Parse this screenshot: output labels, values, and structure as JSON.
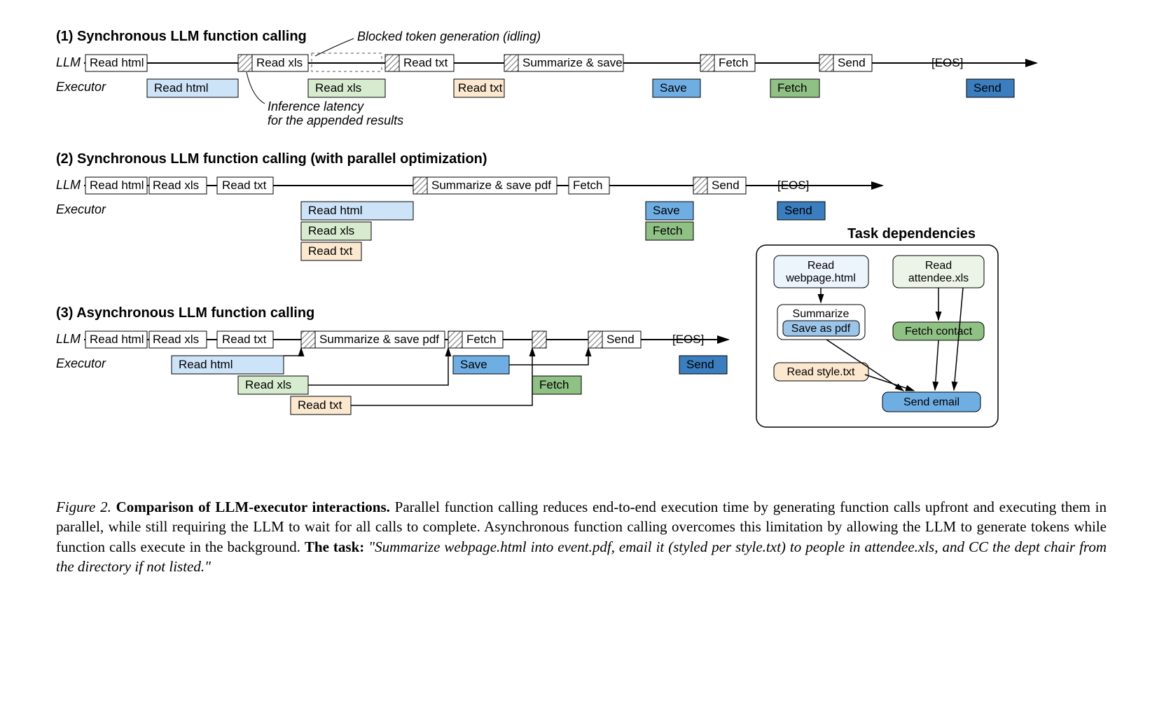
{
  "section1": {
    "title": "(1) Synchronous LLM function calling",
    "llm_label": "LLM",
    "exec_label": "Executor",
    "anno_blocked": "Blocked token generation (idling)",
    "anno_latency1": "Inference latency",
    "anno_latency2": "for the appended results",
    "tokens": {
      "read_html": "Read html",
      "read_xls": "Read xls",
      "read_txt": "Read txt",
      "summarize_save": "Summarize & save",
      "fetch": "Fetch",
      "send": "Send",
      "eos": "[EOS]"
    },
    "exec": {
      "read_html": "Read html",
      "read_xls": "Read xls",
      "read_txt": "Read txt",
      "save": "Save",
      "fetch": "Fetch",
      "send": "Send"
    }
  },
  "section2": {
    "title": "(2) Synchronous LLM function calling (with parallel optimization)",
    "llm_label": "LLM",
    "exec_label": "Executor",
    "tokens": {
      "read_html": "Read html",
      "read_xls": "Read xls",
      "read_txt": "Read txt",
      "summarize_save_pdf": "Summarize & save pdf",
      "fetch": "Fetch",
      "send": "Send",
      "eos": "[EOS]"
    },
    "exec": {
      "read_html": "Read html",
      "read_xls": "Read xls",
      "read_txt": "Read txt",
      "save": "Save",
      "fetch": "Fetch",
      "send": "Send"
    }
  },
  "section3": {
    "title": "(3) Asynchronous LLM function calling",
    "llm_label": "LLM",
    "exec_label": "Executor",
    "tokens": {
      "read_html": "Read html",
      "read_xls": "Read xls",
      "read_txt": "Read txt",
      "summarize_save_pdf": "Summarize & save pdf",
      "fetch": "Fetch",
      "send": "Send",
      "eos": "[EOS]"
    },
    "exec": {
      "read_html": "Read html",
      "read_xls": "Read xls",
      "read_txt": "Read txt",
      "save": "Save",
      "fetch": "Fetch",
      "send": "Send"
    }
  },
  "dependencies": {
    "title": "Task dependencies",
    "read_html1": "Read",
    "read_html2": "webpage.html",
    "read_xls1": "Read",
    "read_xls2": "attendee.xls",
    "summarize": "Summarize",
    "save_as_pdf": "Save as pdf",
    "read_style": "Read style.txt",
    "fetch_contact": "Fetch contact",
    "send_email": "Send email"
  },
  "caption": {
    "fig": "Figure 2.",
    "bold1": "Comparison of LLM-executor interactions.",
    "body1": " Parallel function calling reduces end-to-end execution time by generating function calls upfront and executing them in parallel, while still requiring the LLM to wait for all calls to complete. Asynchronous function calling overcomes this limitation by allowing the LLM to generate tokens while function calls execute in the background. ",
    "bold2": "The task:",
    "italic": " \"Summarize webpage.html into event.pdf, email it (styled per style.txt) to people in attendee.xls, and CC the dept chair from the directory if not listed.\""
  },
  "colors": {
    "blue_light": "#cde3f8",
    "blue_mid": "#6faee3",
    "blue_dark": "#3a7ec0",
    "green_light": "#d7eccf",
    "green_mid": "#8fc084",
    "green_dark": "#5e9c55",
    "peach": "#fbe8cf"
  }
}
